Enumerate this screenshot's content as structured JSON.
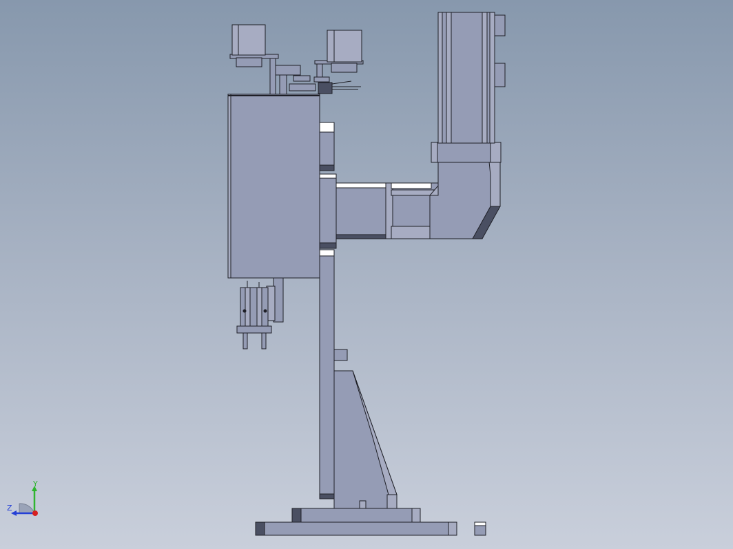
{
  "triad": {
    "y_label": "Y",
    "z_label": "Z",
    "colors": {
      "y_axis": "#2fb52f",
      "z_axis": "#2540d6",
      "x_axis": "#d62020"
    }
  },
  "colors": {
    "bg_top": "#8798ad",
    "bg_bottom": "#c9cfdb",
    "part_face": "#959cb5",
    "part_light": "#a7acc2",
    "part_dark": "#4a4f62",
    "highlight": "#ffffff",
    "edge": "#1e1f26"
  }
}
